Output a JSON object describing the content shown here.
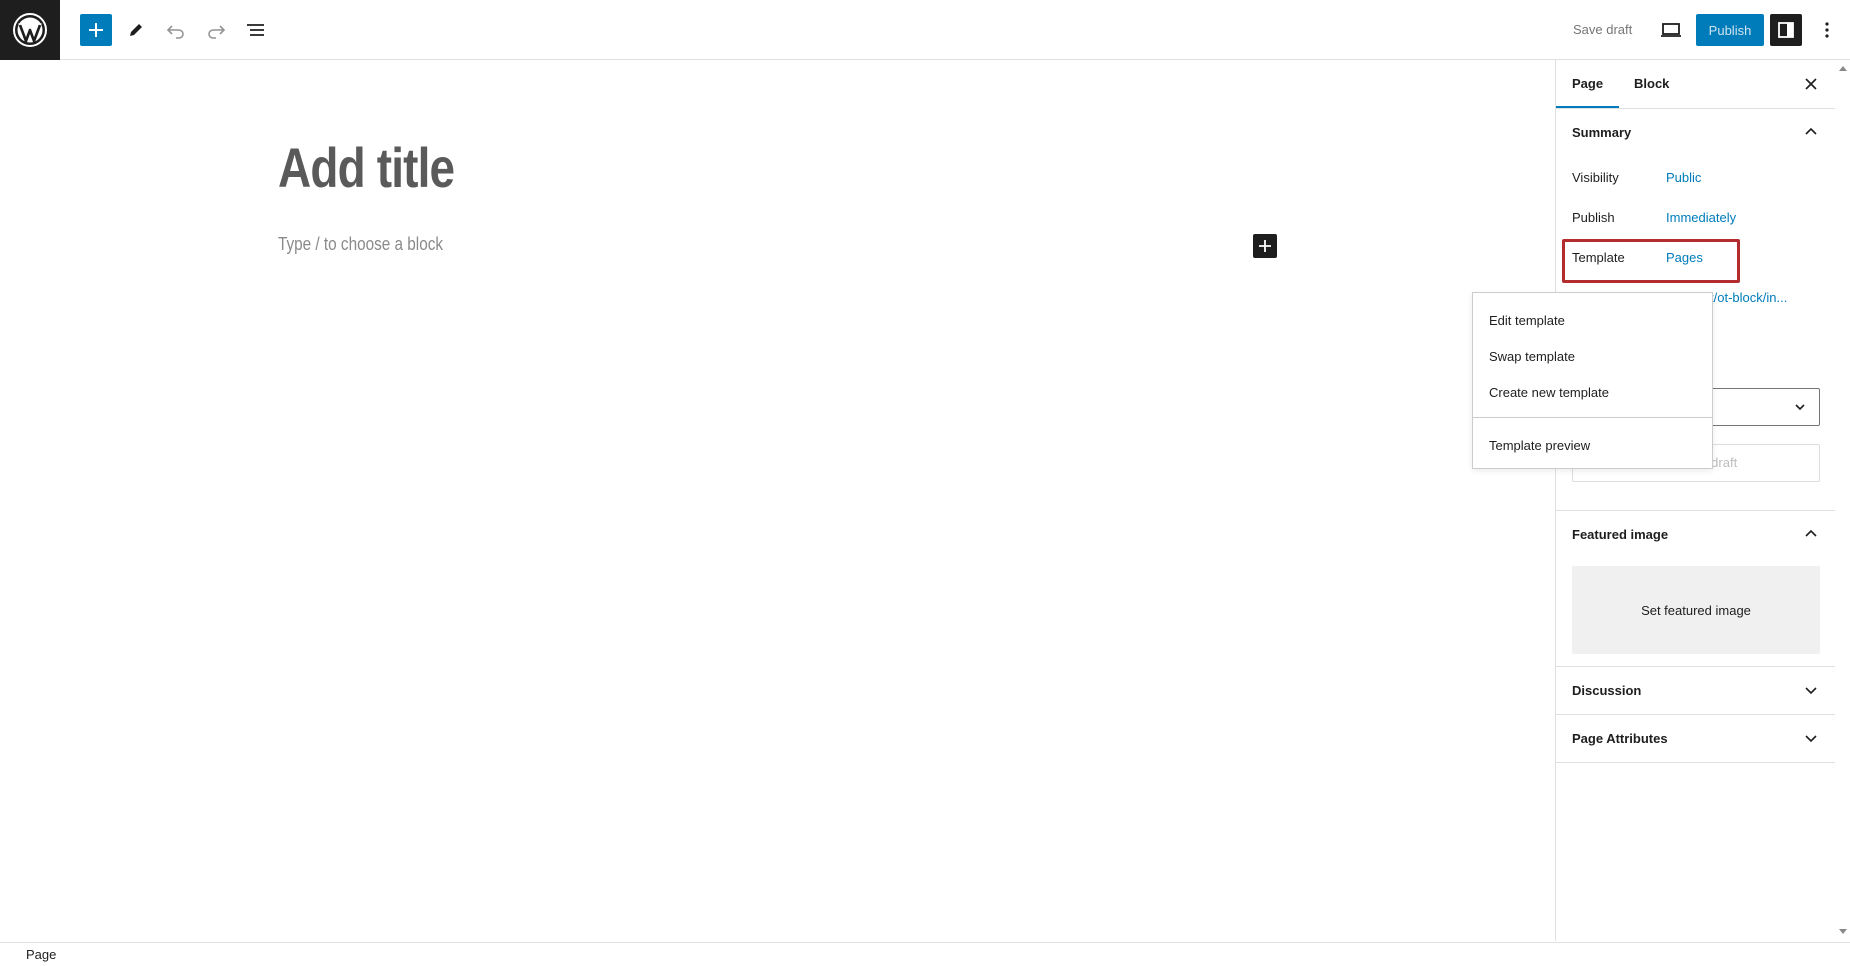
{
  "toolbar": {
    "save_draft": "Save draft",
    "publish": "Publish"
  },
  "editor": {
    "title_placeholder": "Add title",
    "block_placeholder": "Type / to choose a block"
  },
  "sidebar": {
    "tabs": [
      {
        "label": "Page"
      },
      {
        "label": "Block"
      }
    ],
    "summary": {
      "heading": "Summary",
      "rows": [
        {
          "label": "Visibility",
          "value": "Public"
        },
        {
          "label": "Publish",
          "value": "Immediately"
        },
        {
          "label": "Template",
          "value": "Pages"
        }
      ],
      "url_partial": "t/ot-block/in...",
      "switch_to_draft": "Switch to draft"
    },
    "featured_image": {
      "heading": "Featured image",
      "button": "Set featured image"
    },
    "discussion": {
      "heading": "Discussion"
    },
    "page_attributes": {
      "heading": "Page Attributes"
    }
  },
  "template_menu": {
    "items": [
      {
        "label": "Edit template"
      },
      {
        "label": "Swap template"
      },
      {
        "label": "Create new template"
      },
      {
        "label": "Template preview"
      }
    ]
  },
  "footer": {
    "breadcrumb": "Page"
  },
  "colors": {
    "accent": "#007cba",
    "dark": "#1e1e1e",
    "highlight": "#b32d2e"
  }
}
